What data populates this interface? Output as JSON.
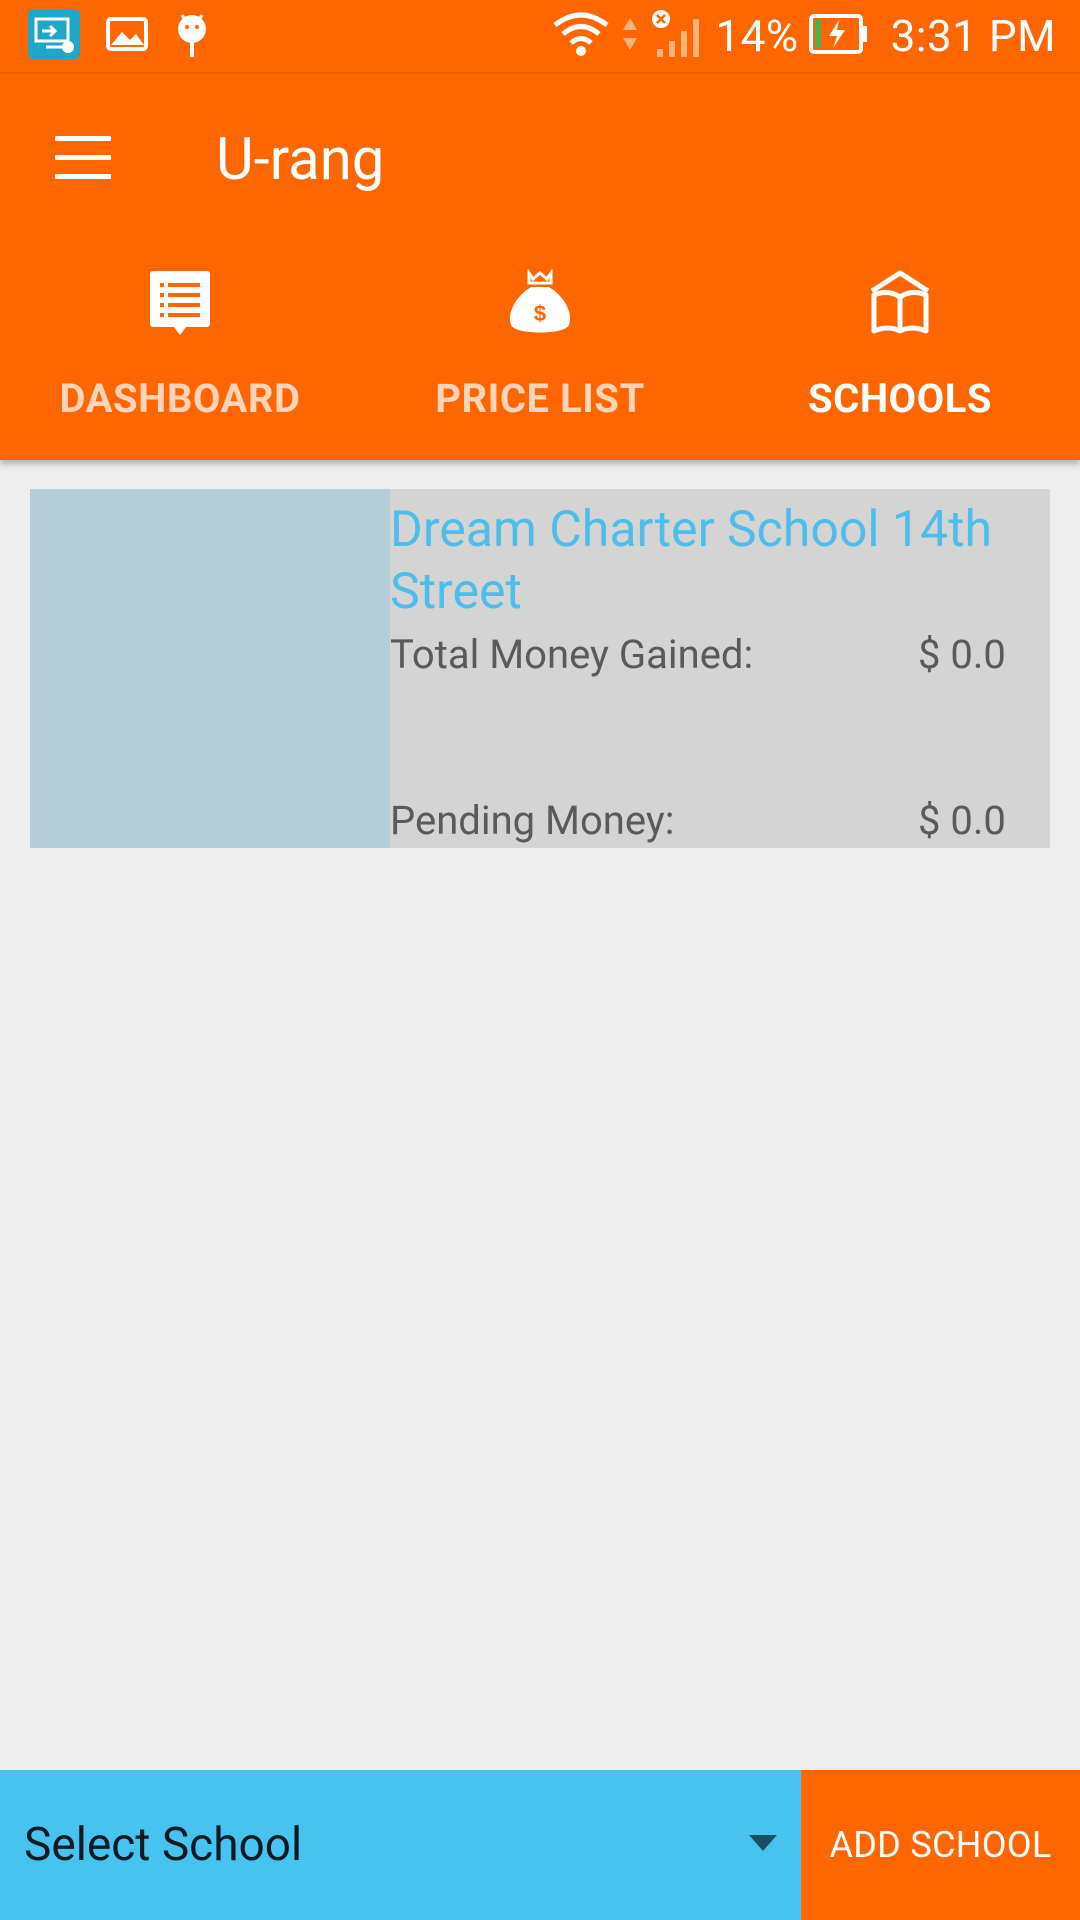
{
  "status_bar": {
    "battery_percent": "14%",
    "time": "3:31 PM",
    "icons": [
      "remote-desktop-icon",
      "gallery-icon",
      "android-debug-icon",
      "wifi-icon",
      "signal-icon",
      "battery-charging-icon"
    ]
  },
  "app_bar": {
    "title": "U-rang",
    "menu_icon": "hamburger-menu-icon"
  },
  "tabs": [
    {
      "label": "DASHBOARD",
      "icon": "dashboard-icon",
      "active": false
    },
    {
      "label": "PRICE LIST",
      "icon": "money-bag-icon",
      "active": false
    },
    {
      "label": "SCHOOLS",
      "icon": "book-icon",
      "active": true
    }
  ],
  "school_card": {
    "name": "Dream Charter School 14th Street",
    "total_money_label": "Total Money Gained:",
    "total_money_value": "$ 0.0",
    "pending_money_label": "Pending Money:",
    "pending_money_value": "$ 0.0"
  },
  "bottom_bar": {
    "select_placeholder": "Select School",
    "add_button_label": "ADD SCHOOL"
  },
  "colors": {
    "primary": "#ff6600",
    "accent": "#46c3ef",
    "school_name": "#4dbde9",
    "background": "#eeeeee"
  }
}
